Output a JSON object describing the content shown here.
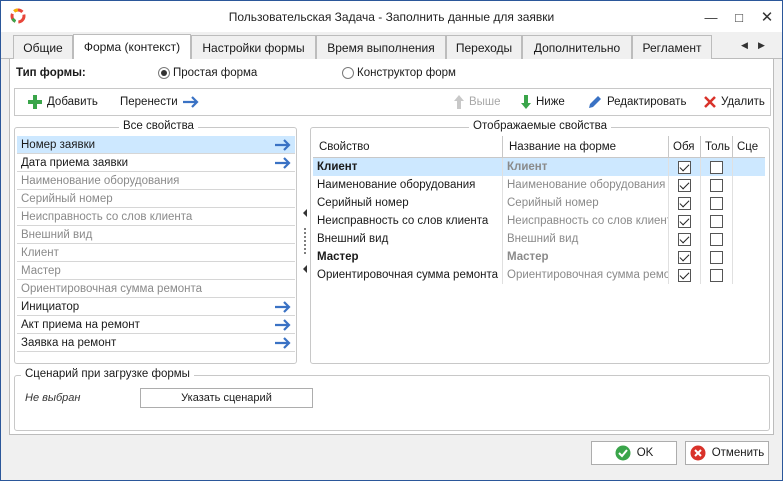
{
  "window": {
    "title": "Пользовательская Задача - Заполнить данные для заявки"
  },
  "tabs": [
    "Общие",
    "Форма (контекст)",
    "Настройки формы",
    "Время выполнения",
    "Переходы",
    "Дополнительно",
    "Регламент"
  ],
  "form_type": {
    "label": "Тип формы:",
    "options": [
      "Простая форма",
      "Конструктор форм"
    ],
    "selected": "Простая форма"
  },
  "toolbar": {
    "add": "Добавить",
    "move": "Перенести",
    "up": "Выше",
    "down": "Ниже",
    "edit": "Редактировать",
    "delete": "Удалить"
  },
  "all_props": {
    "title": "Все свойства",
    "items": [
      {
        "label": "Номер заявки"
      },
      {
        "label": "Дата приема заявки"
      },
      {
        "label": "Наименование оборудования"
      },
      {
        "label": "Серийный номер"
      },
      {
        "label": "Неисправность со слов клиента"
      },
      {
        "label": "Внешний вид"
      },
      {
        "label": "Клиент"
      },
      {
        "label": "Мастер"
      },
      {
        "label": "Ориентировочная сумма ремонта"
      },
      {
        "label": "Инициатор"
      },
      {
        "label": "Акт приема на ремонт"
      },
      {
        "label": "Заявка на ремонт"
      }
    ]
  },
  "displayed": {
    "title": "Отображаемые свойства",
    "columns": [
      "Свойство",
      "Название на форме",
      "Обя",
      "Толь",
      "Сце"
    ],
    "rows": [
      {
        "prop": "Клиент",
        "name": "Клиент",
        "required": true,
        "readonly": false
      },
      {
        "prop": "Наименование оборудования",
        "name": "Наименование оборудования",
        "required": true,
        "readonly": false
      },
      {
        "prop": "Серийный номер",
        "name": "Серийный номер",
        "required": true,
        "readonly": false
      },
      {
        "prop": "Неисправность со слов клиента",
        "name": "Неисправность со слов клиента",
        "required": true,
        "readonly": false
      },
      {
        "prop": "Внешний вид",
        "name": "Внешний вид",
        "required": true,
        "readonly": false
      },
      {
        "prop": "Мастер",
        "name": "Мастер",
        "required": true,
        "readonly": false
      },
      {
        "prop": "Ориентировочная сумма ремонта",
        "name": "Ориентировочная сумма ремонта",
        "required": true,
        "readonly": false
      }
    ]
  },
  "scenario": {
    "title": "Сценарий при загрузке формы",
    "value": "Не выбран",
    "button": "Указать сценарий"
  },
  "footer": {
    "ok": "OK",
    "cancel": "Отменить"
  }
}
